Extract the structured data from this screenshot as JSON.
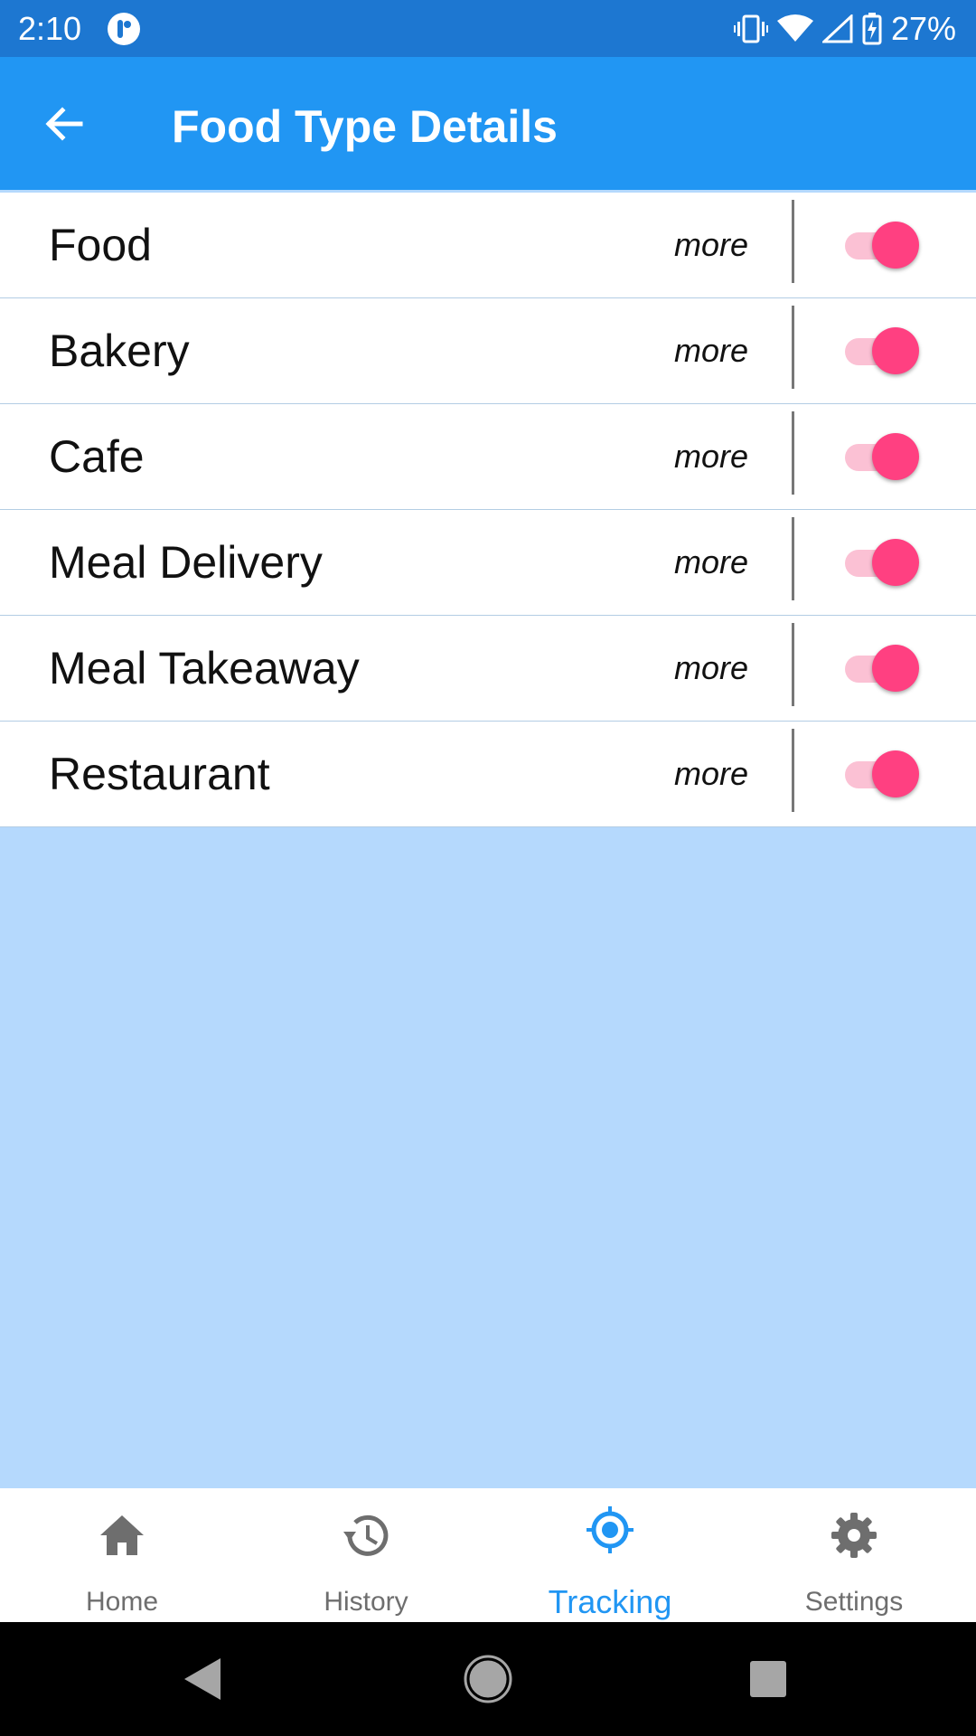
{
  "status_bar": {
    "time": "2:10",
    "battery_percent": "27%",
    "icons": [
      "app-notification-icon",
      "vibrate-icon",
      "wifi-icon",
      "cell-signal-icon",
      "battery-charging-icon"
    ]
  },
  "app_bar": {
    "title": "Food Type Details",
    "back_icon": "arrow-back-icon",
    "color": "#2196f3"
  },
  "food_types": {
    "items": [
      {
        "label": "Food",
        "more": "more",
        "enabled": true
      },
      {
        "label": "Bakery",
        "more": "more",
        "enabled": true
      },
      {
        "label": "Cafe",
        "more": "more",
        "enabled": true
      },
      {
        "label": "Meal Delivery",
        "more": "more",
        "enabled": true
      },
      {
        "label": "Meal Takeaway",
        "more": "more",
        "enabled": true
      },
      {
        "label": "Restaurant",
        "more": "more",
        "enabled": true
      }
    ],
    "toggle_color": "#ff4081"
  },
  "bottom_nav": {
    "items": [
      {
        "label": "Home",
        "icon": "home-icon",
        "active": false
      },
      {
        "label": "History",
        "icon": "history-icon",
        "active": false
      },
      {
        "label": "Tracking",
        "icon": "gps-fixed-icon",
        "active": true
      },
      {
        "label": "Settings",
        "icon": "gear-icon",
        "active": false
      }
    ],
    "active_color": "#2196f3"
  },
  "system_nav": {
    "icons": [
      "back-triangle-icon",
      "home-circle-icon",
      "recents-square-icon"
    ]
  }
}
